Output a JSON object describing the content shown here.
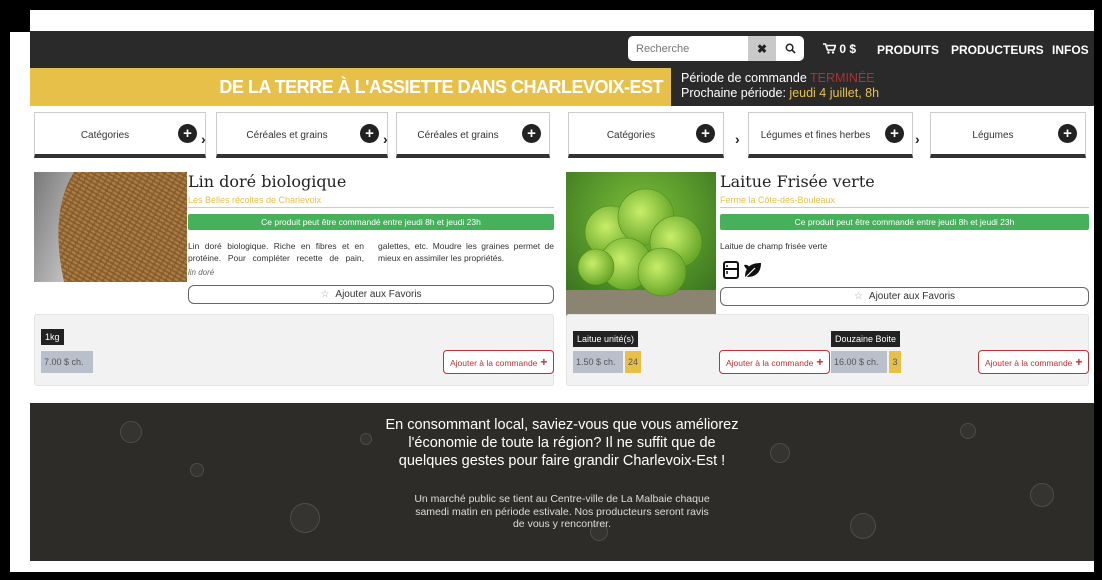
{
  "header": {
    "search_placeholder": "Recherche",
    "clear_label": "✖",
    "search_icon": "🔍",
    "cart_label": "0 $",
    "nav": [
      "PRODUITS",
      "PRODUCTEURS",
      "INFOS"
    ]
  },
  "banner": {
    "title": "DE LA TERRE À L'ASSIETTE DANS CHARLEVOIX-EST",
    "period_label": "Période de commande",
    "period_status": "TERMINÉE",
    "next_label": "Prochaine période:",
    "next_date": "jeudi 4 juillet, 8h"
  },
  "crumbs": [
    "Catégories",
    "Céréales et grains",
    "Céréales et grains",
    "Catégories",
    "Légumes et fines herbes",
    "Légumes"
  ],
  "products": [
    {
      "title": "Lin doré biologique",
      "producer": "Les Belles récoltes de Charlevoix",
      "availability": "Ce produit peut être commandé entre jeudi 8h et jeudi 23h",
      "description": "Lin doré biologique. Riche en fibres et en protéine. Pour compléter recette de pain, galettes, etc. Moudre les graines permet de mieux en assimiler les propriétés.",
      "tag": "lin doré",
      "favorite": "Ajouter aux Favoris",
      "options": [
        {
          "unit": "1kg",
          "price": "7.00 $ ch.",
          "qty": "",
          "add": "Ajouter à la commande"
        }
      ]
    },
    {
      "title": "Laitue Frisée verte",
      "producer": "Ferme la Côte-des-Bouleaux",
      "availability": "Ce produit peut être commandé entre jeudi 8h et jeudi 23h",
      "description": "Laitue de champ frisée verte",
      "icons": [
        "fridge-icon",
        "leaf-icon"
      ],
      "favorite": "Ajouter aux Favoris",
      "options": [
        {
          "unit": "Laitue unité(s)",
          "price": "1.50 $ ch.",
          "qty": "24",
          "add": "Ajouter à la commande"
        },
        {
          "unit": "Douzaine Boite",
          "price": "16.00 $ ch.",
          "qty": "3",
          "add": "Ajouter à la commande"
        }
      ]
    }
  ],
  "footer": {
    "headline": "En consommant local, saviez-vous que vous améliorez l'économie de toute la région? Il ne suffit que de quelques gestes pour faire grandir Charlevoix-Est !",
    "body": "Un marché public se tient au Centre-ville de La Malbaie chaque samedi matin en période estivale. Nos producteurs seront ravis de vous y rencontrer."
  }
}
